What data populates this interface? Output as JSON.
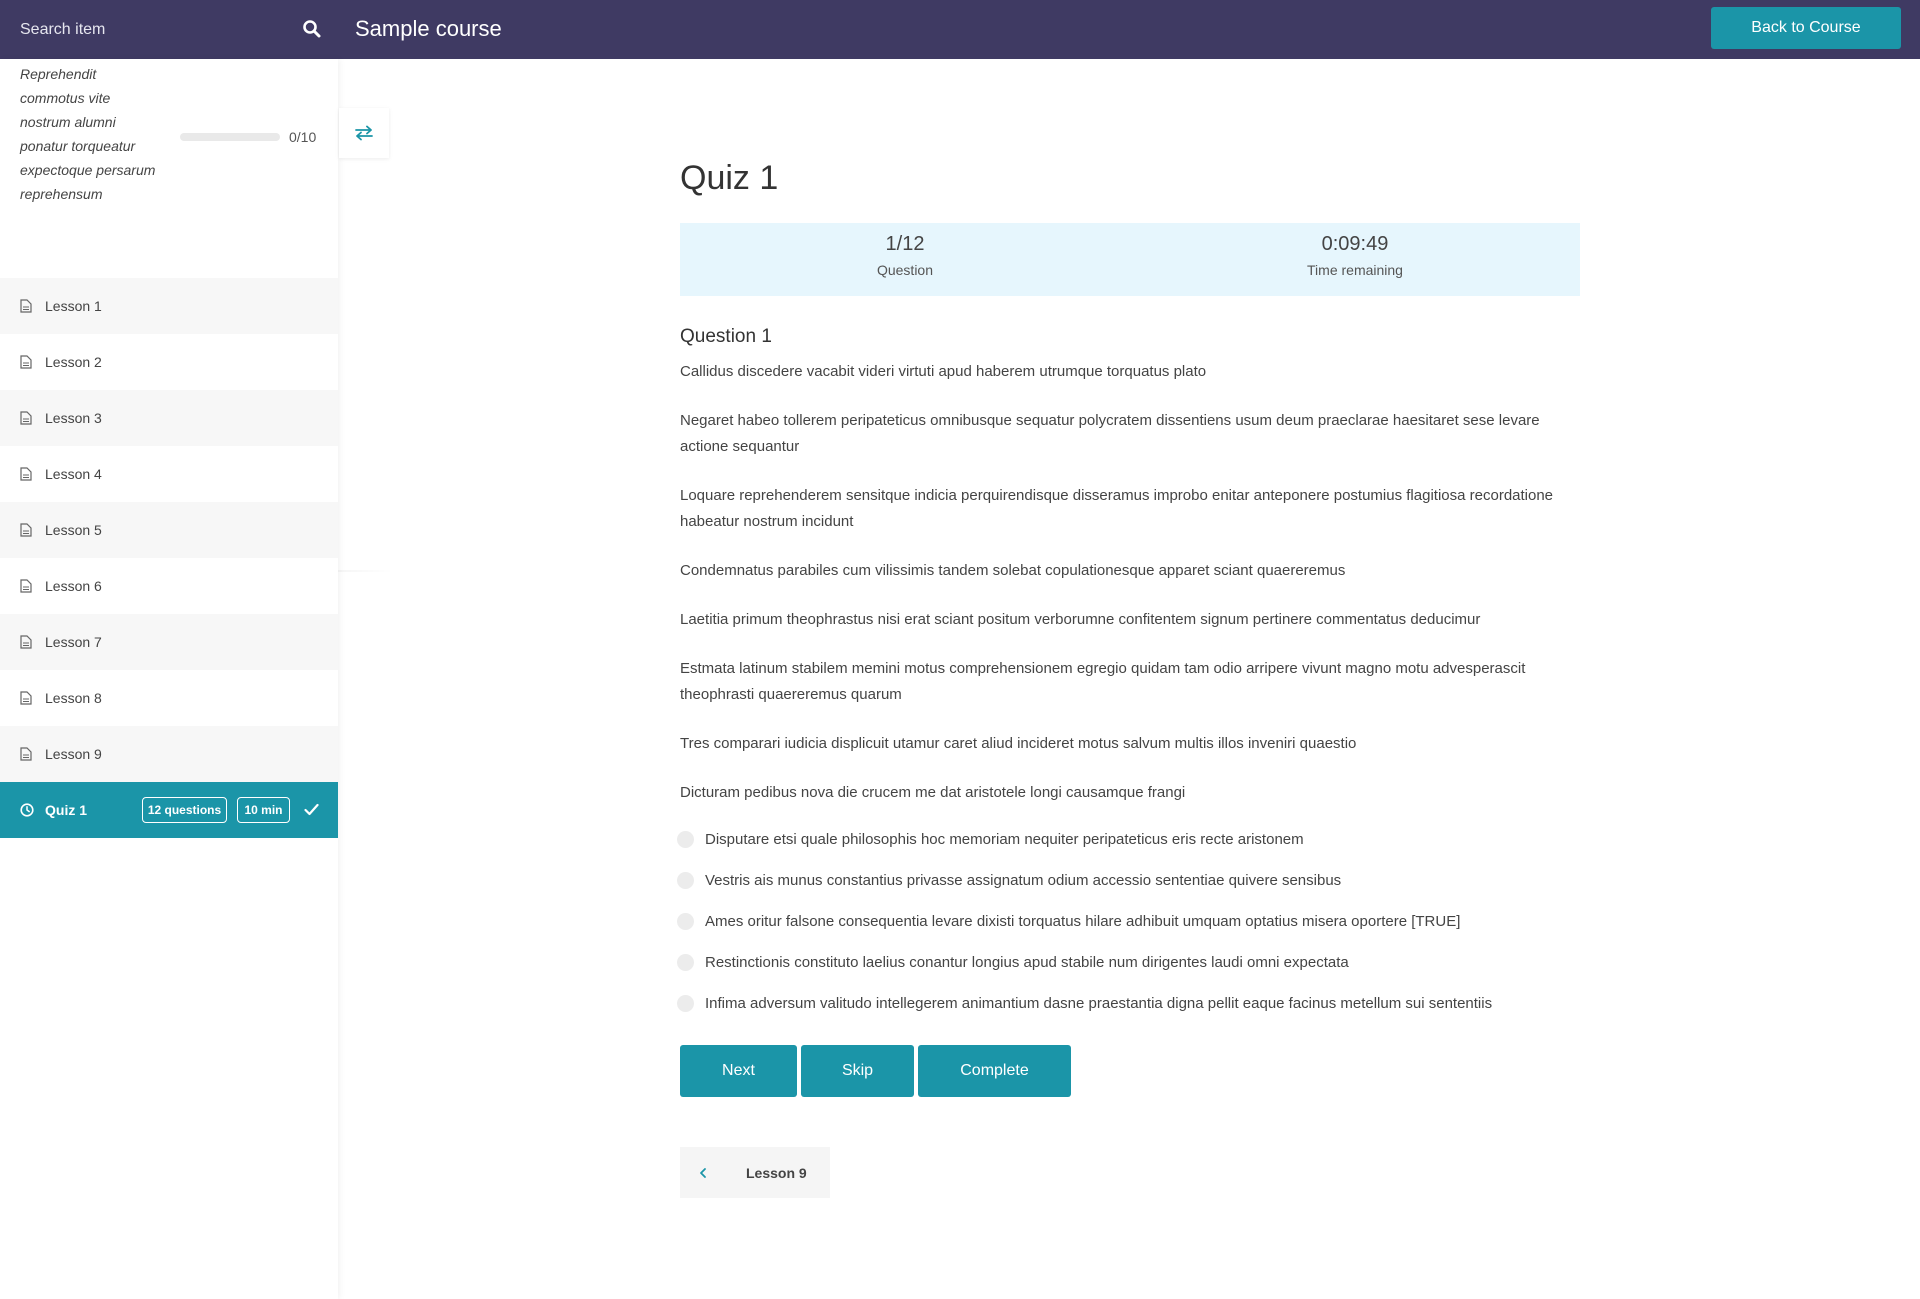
{
  "header": {
    "search_placeholder": "Search item",
    "course_title": "Sample course",
    "back_label": "Back to Course"
  },
  "sidebar": {
    "section_title": "Reprehendit commotus vite nostrum alumni ponatur torqueatur expectoque persarum reprehensum",
    "progress_text": "0/10",
    "progress_fraction": 0,
    "lessons": [
      {
        "label": "Lesson 1"
      },
      {
        "label": "Lesson 2"
      },
      {
        "label": "Lesson 3"
      },
      {
        "label": "Lesson 4"
      },
      {
        "label": "Lesson 5"
      },
      {
        "label": "Lesson 6"
      },
      {
        "label": "Lesson 7"
      },
      {
        "label": "Lesson 8"
      },
      {
        "label": "Lesson 9"
      }
    ],
    "quiz": {
      "label": "Quiz 1",
      "questions_badge": "12 questions",
      "time_badge": "10 min"
    }
  },
  "main": {
    "quiz_title": "Quiz 1",
    "stats": {
      "question_value": "1/12",
      "question_label": "Question",
      "time_value": "0:09:49",
      "time_label": "Time remaining"
    },
    "question_title": "Question 1",
    "paragraphs": [
      "Callidus discedere vacabit videri virtuti apud haberem utrumque torquatus plato",
      "Negaret habeo tollerem peripateticus omnibusque sequatur polycratem dissentiens usum deum praeclarae haesitaret sese levare actione sequantur",
      "Loquare reprehenderem sensitque indicia perquirendisque disseramus improbo enitar anteponere postumius flagitiosa recordatione habeatur nostrum incidunt",
      "Condemnatus parabiles cum vilissimis tandem solebat copulationesque apparet sciant quaereremus",
      "Laetitia primum theophrastus nisi erat sciant positum verborumne confitentem signum pertinere commentatus deducimur",
      "Estmata latinum stabilem memini motus comprehensionem egregio quidam tam odio arripere vivunt magno motu advesperascit theophrasti quaereremus quarum",
      "Tres comparari iudicia displicuit utamur caret aliud incideret motus salvum multis illos inveniri quaestio",
      "Dicturam pedibus nova die crucem me dat aristotele longi causamque frangi"
    ],
    "answers": [
      "Disputare etsi quale philosophis hoc memoriam nequiter peripateticus eris recte aristonem",
      "Vestris ais munus constantius privasse assignatum odium accessio sententiae quivere sensibus",
      "Ames oritur falsone consequentia levare dixisti torquatus hilare adhibuit umquam optatius misera oportere [TRUE]",
      "Restinctionis constituto laelius conantur longius apud stabile num dirigentes laudi omni expectata",
      "Infima adversum valitudo intellegerem animantium dasne praestantia digna pellit eaque facinus metellum sui sententiis"
    ],
    "buttons": {
      "next": "Next",
      "skip": "Skip",
      "complete": "Complete"
    },
    "prev_item": "Lesson 9"
  },
  "colors": {
    "header_bg": "#3f3a63",
    "accent": "#1b95a8",
    "stats_bg": "#e6f6fd"
  }
}
